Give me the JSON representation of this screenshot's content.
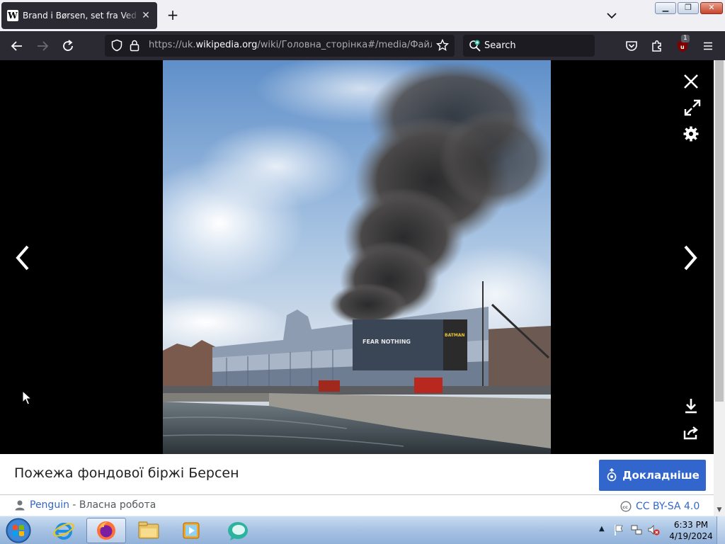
{
  "browser": {
    "tab": {
      "favicon_letter": "W",
      "title": "Brand i Børsen, set fra Ved Stranden"
    },
    "url": {
      "prefix": "https://uk.",
      "domain": "wikipedia.org",
      "path": "/wiki/Головна_сторінка#/media/Файл:Brand_i_Børsen"
    },
    "search_placeholder": "Search",
    "addon_badge": "1"
  },
  "viewer": {
    "caption": "Пожежа фондової біржі Берсен",
    "more_button": "Докладніше",
    "author_name": "Penguin",
    "author_suffix": " - Власна робота",
    "license": "CC BY-SA 4.0",
    "billboard_text": "FEAR NOTHING",
    "billboard_brand": "BATMAN"
  },
  "taskbar": {
    "time": "6:33 PM",
    "date": "4/19/2024"
  },
  "colors": {
    "accent": "#3366cc",
    "browser_chrome": "#2b2a33"
  }
}
